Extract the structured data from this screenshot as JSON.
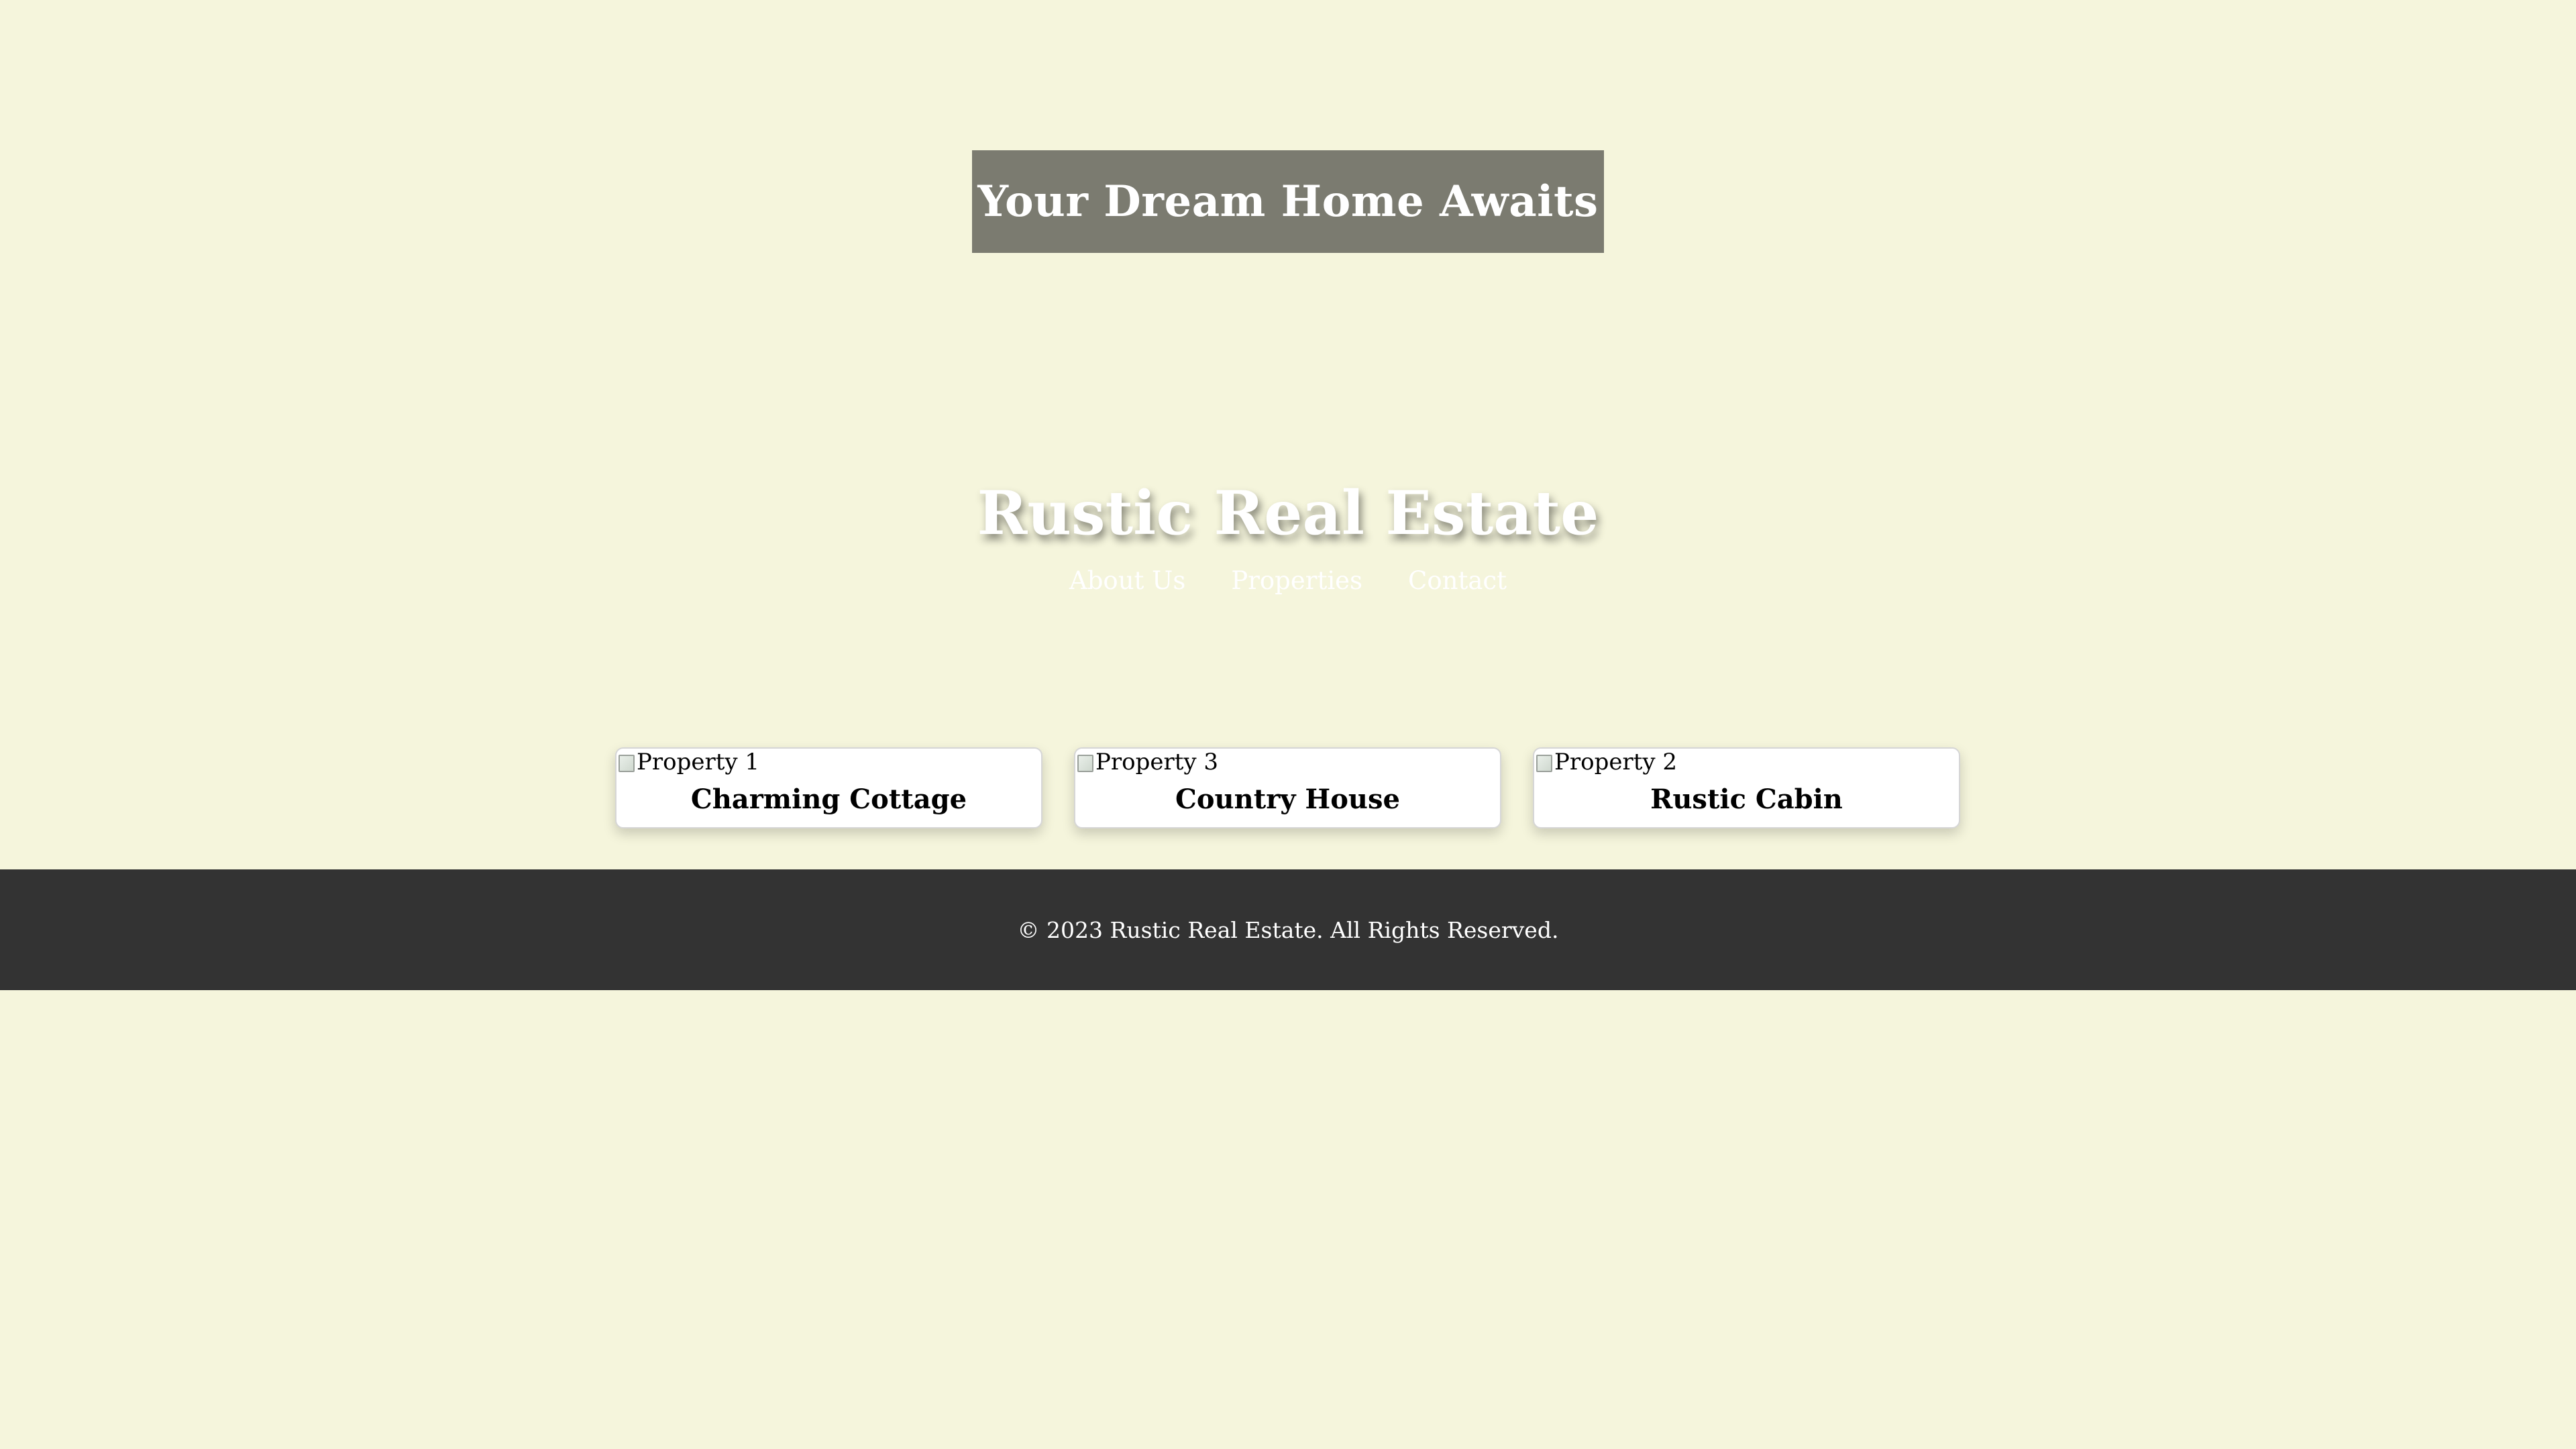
{
  "hero": {
    "title": "Your Dream Home Awaits"
  },
  "header": {
    "site_title": "Rustic Real Estate",
    "nav": [
      {
        "label": "About Us"
      },
      {
        "label": "Properties"
      },
      {
        "label": "Contact"
      }
    ]
  },
  "properties": [
    {
      "image_alt": "Property 1",
      "title": "Charming Cottage",
      "icon": "broken-image-icon"
    },
    {
      "image_alt": "Property 3",
      "title": "Country House",
      "icon": "broken-image-icon"
    },
    {
      "image_alt": "Property 2",
      "title": "Rustic Cabin",
      "icon": "broken-image-icon"
    }
  ],
  "footer": {
    "text": "© 2023 Rustic Real Estate. All Rights Reserved."
  },
  "colors": {
    "background": "#f5f5dc",
    "hero_box": "#6e6e64",
    "footer": "#333333",
    "text_light": "#ffffff"
  }
}
